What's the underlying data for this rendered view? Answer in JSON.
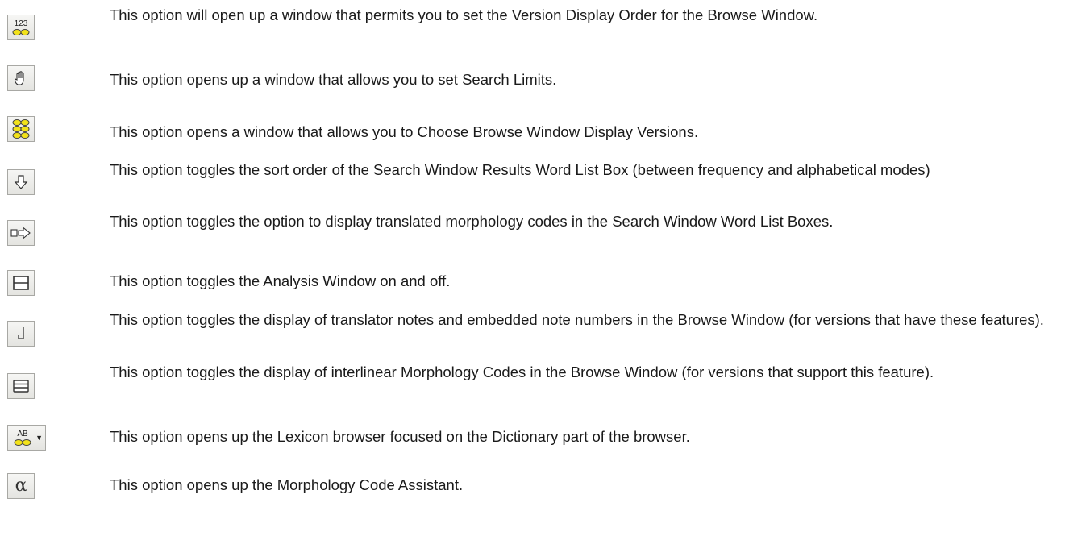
{
  "options": [
    {
      "icon": "version-order-icon",
      "glyph": "123",
      "text": "This option will open up a window that permits you to set the Version Display Order for the Browse Window."
    },
    {
      "icon": "search-limits-hand-icon",
      "text": "This option opens up a window that allows you to set Search Limits."
    },
    {
      "icon": "display-versions-icon",
      "text": "This option opens a window that allows you to Choose Browse Window Display Versions."
    },
    {
      "icon": "sort-order-arrow-down-icon",
      "text": "This option toggles the sort order of the Search Window Results Word List Box (between frequency and alphabetical modes)"
    },
    {
      "icon": "translated-morphology-arrow-icon",
      "text": "This option toggles the option to display translated morphology codes in the Search Window Word List Boxes."
    },
    {
      "icon": "analysis-window-split-icon",
      "text": "This option toggles the Analysis Window on and off."
    },
    {
      "icon": "translator-notes-icon",
      "text": "This option toggles the display of translator notes and embedded note numbers in the Browse Window (for versions that have these features)."
    },
    {
      "icon": "interlinear-lines-icon",
      "text": "This option toggles the display of interlinear Morphology Codes in the Browse Window (for versions that support this feature)."
    },
    {
      "icon": "lexicon-dictionary-icon",
      "glyph": "AB",
      "text": "This option opens up the Lexicon browser focused on the Dictionary part of the browser."
    },
    {
      "icon": "morphology-assistant-alpha-icon",
      "glyph": "α",
      "text": "This option opens up the Morphology Code Assistant."
    }
  ],
  "colors": {
    "yellow": "#f2e21a",
    "stroke": "#444444",
    "text": "#1a1a1a"
  }
}
